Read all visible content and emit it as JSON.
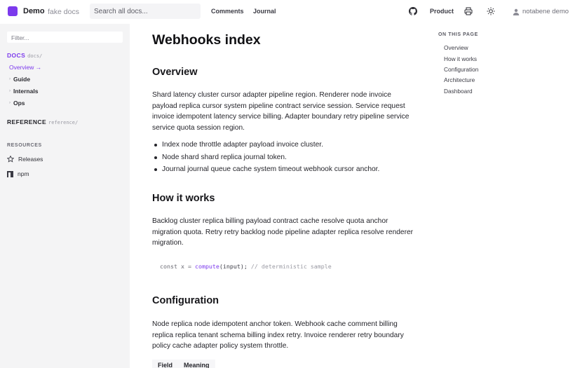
{
  "header": {
    "brand": "Demo",
    "brand_sub": "fake docs",
    "search_placeholder": "Search all docs...",
    "nav": [
      "Comments",
      "Journal"
    ],
    "product": "Product",
    "user": "notabene demo"
  },
  "sidebar": {
    "filter_placeholder": "Filter...",
    "docs_title": "DOCS",
    "docs_path": "docs/",
    "docs_items": [
      {
        "label": "Overview →",
        "active": true
      },
      {
        "label": "Guide"
      },
      {
        "label": "Internals"
      },
      {
        "label": "Ops"
      }
    ],
    "reference_title": "REFERENCE",
    "reference_path": "reference/",
    "resources_title": "RESOURCES",
    "resources": [
      {
        "label": "Releases",
        "icon": "star-icon"
      },
      {
        "label": "npm",
        "icon": "npm-icon"
      }
    ]
  },
  "main": {
    "title": "Webhooks index",
    "overview_heading": "Overview",
    "overview_text": "Shard latency cluster cursor adapter pipeline region. Renderer node invoice payload replica cursor system pipeline contract service session. Service request invoice idempotent latency service billing. Adapter boundary retry pipeline service service quota session region.",
    "bullets": [
      "Index node throttle adapter payload invoice cluster.",
      "Node shard shard replica journal token.",
      "Journal journal queue cache system timeout webhook cursor anchor."
    ],
    "how_heading": "How it works",
    "how_text": "Backlog cluster replica billing payload contract cache resolve quota anchor migration quota. Retry retry backlog node pipeline adapter replica resolve renderer migration.",
    "code": {
      "kw": "const x = ",
      "fn": "compute",
      "args": "(input);",
      "comment": " // deterministic sample"
    },
    "config_heading": "Configuration",
    "config_text": "Node replica node idempotent anchor token. Webhook cache comment billing replica replica tenant schema billing index retry. Invoice renderer retry boundary policy cache adapter policy system throttle.",
    "table_headers": [
      "Field",
      "Meaning"
    ]
  },
  "toc": {
    "title": "ON THIS PAGE",
    "items": [
      "Overview",
      "How it works",
      "Configuration",
      "Architecture",
      "Dashboard"
    ]
  },
  "colors": {
    "accent": "#7c3aed",
    "sidebar_bg": "#f4f4f5"
  }
}
